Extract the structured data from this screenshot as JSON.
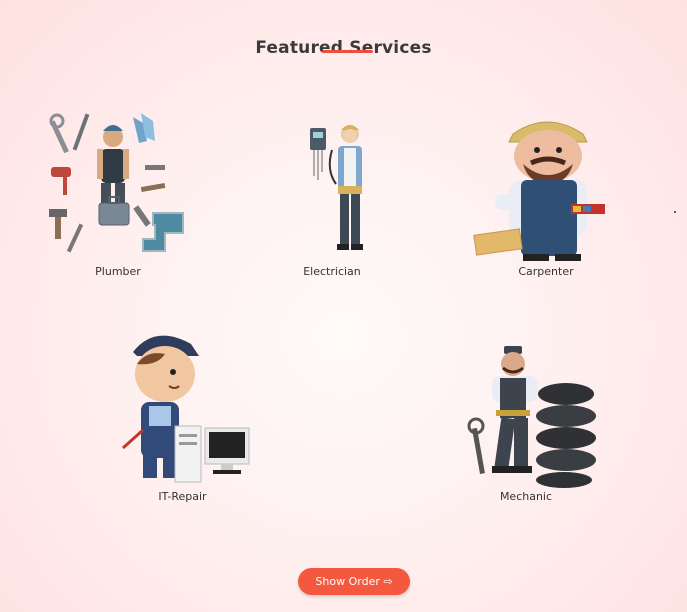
{
  "section": {
    "title": "Featured Services"
  },
  "services": [
    {
      "label": "Plumber",
      "icon": "plumber-icon"
    },
    {
      "label": "Electrician",
      "icon": "electrician-icon"
    },
    {
      "label": "Carpenter",
      "icon": "carpenter-icon"
    },
    {
      "label": "IT-Repair",
      "icon": "it-repair-icon"
    },
    {
      "label": "Mechanic",
      "icon": "mechanic-icon"
    }
  ],
  "actions": {
    "show_order_label": "Show Order ⇨"
  },
  "colors": {
    "accent": "#f4583e",
    "underline": "#ef4f3a",
    "background": "#ffeaea"
  }
}
